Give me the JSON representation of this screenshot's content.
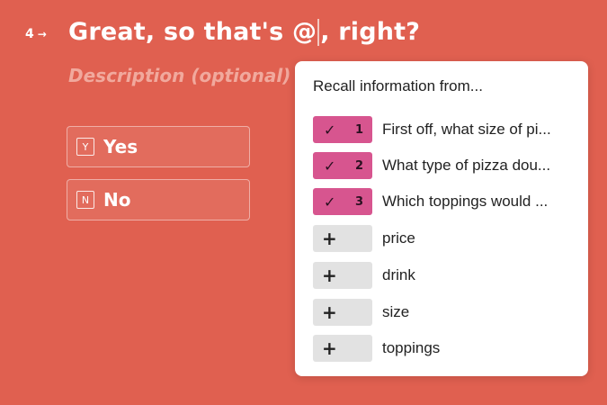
{
  "question": {
    "number": "4",
    "arrow": "→",
    "text_before": "Great, so that's @",
    "text_after": ", right?",
    "description_placeholder": "Description (optional)"
  },
  "choices": [
    {
      "key": "Y",
      "label": "Yes"
    },
    {
      "key": "N",
      "label": "No"
    }
  ],
  "recall_popup": {
    "title": "Recall information from...",
    "items": [
      {
        "type": "question",
        "selected": true,
        "number": "1",
        "text": "First off, what size of pi..."
      },
      {
        "type": "question",
        "selected": true,
        "number": "2",
        "text": "What type of pizza dou..."
      },
      {
        "type": "question",
        "selected": true,
        "number": "3",
        "text": "Which toppings would ..."
      },
      {
        "type": "variable",
        "text": "price"
      },
      {
        "type": "variable",
        "text": "drink"
      },
      {
        "type": "variable",
        "text": "size"
      },
      {
        "type": "variable",
        "text": "toppings"
      }
    ]
  },
  "colors": {
    "background": "#e06050",
    "selected_chip": "#d7558f",
    "add_chip": "#e2e2e2"
  },
  "icons": {
    "check": "✓",
    "plus": "+"
  }
}
